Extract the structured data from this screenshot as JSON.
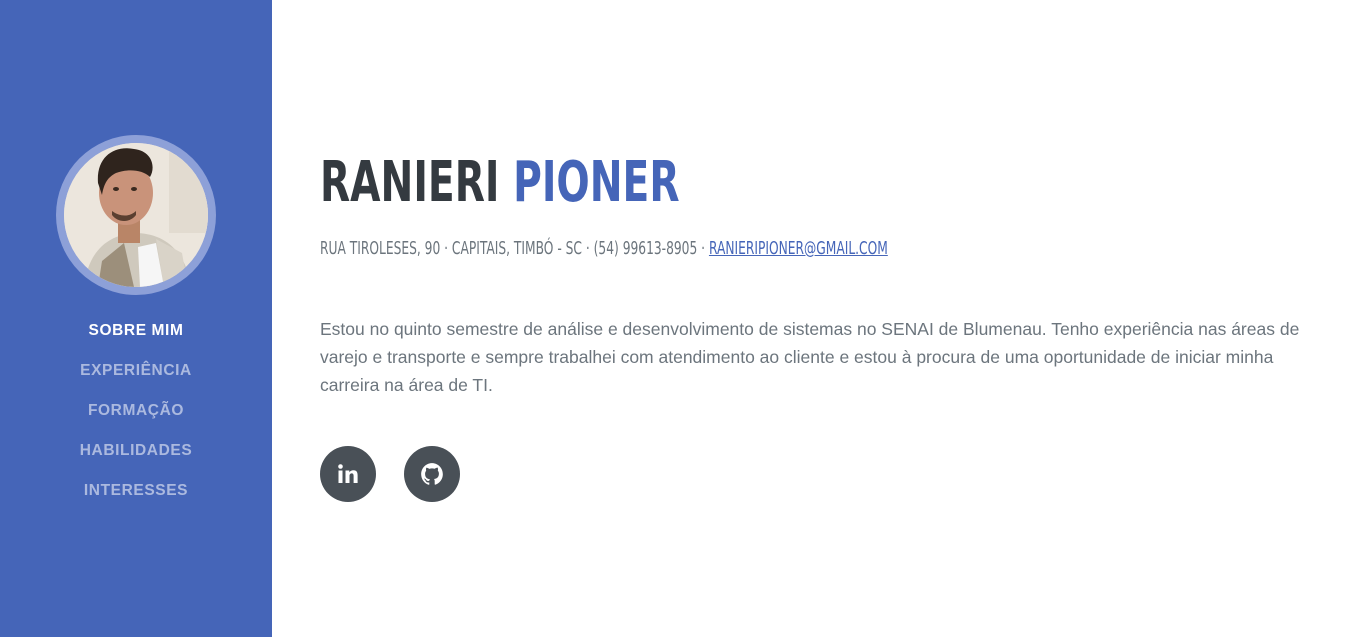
{
  "profile": {
    "first_name": "Ranieri",
    "last_name": "Pioner",
    "address": "Rua Tiroleses, 90 · Capitais, Timbó - SC · (54) 99613-8905 · ",
    "email": "ranieripioner@gmail.com",
    "bio": "Estou no quinto semestre de análise e desenvolvimento de sistemas no SENAI de Blumenau. Tenho experiência nas áreas de varejo e transporte e sempre trabalhei com atendimento ao cliente e estou à procura de uma oportunidade de iniciar minha carreira na área de TI."
  },
  "nav": {
    "items": [
      {
        "label": "Sobre mim",
        "active": true
      },
      {
        "label": "Experiência",
        "active": false
      },
      {
        "label": "Formação",
        "active": false
      },
      {
        "label": "Habilidades",
        "active": false
      },
      {
        "label": "Interesses",
        "active": false
      }
    ]
  },
  "social": {
    "items": [
      {
        "icon": "linkedin-icon"
      },
      {
        "icon": "github-icon"
      }
    ]
  },
  "colors": {
    "primary": "#4565b8",
    "heading": "#343a40",
    "text": "#6c757d",
    "social_bg": "#495057"
  }
}
